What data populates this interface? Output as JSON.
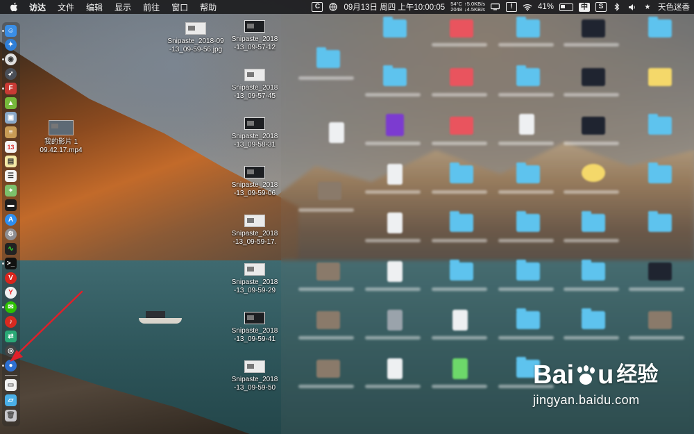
{
  "menubar": {
    "app_name": "访达",
    "menus": [
      "文件",
      "编辑",
      "显示",
      "前往",
      "窗口",
      "帮助"
    ],
    "datetime": "09月13日 周四 上午10:00:05",
    "temperature": "54°C",
    "fan_speed": "2048",
    "net_up": "↑5.0KB/s",
    "net_down": "↓4.5KB/s",
    "battery": "41%",
    "input_method": "中",
    "user_name": "天色迷香"
  },
  "desktop": {
    "movie": {
      "line1": "我的影片 1",
      "line2": "09.42.17.mp4"
    },
    "files": [
      {
        "line1": "Snipaste_2018-09",
        "line2": "-13_09-59-56.jpg"
      },
      {
        "line1": "Snipaste_2018",
        "line2": "-13_09-57-12"
      },
      {
        "line1": "Snipaste_2018",
        "line2": "-13_09-57-45"
      },
      {
        "line1": "Snipaste_2018",
        "line2": "-13_09-58-31"
      },
      {
        "line1": "Snipaste_2018",
        "line2": "-13_09-59-06"
      },
      {
        "line1": "Snipaste_2018",
        "line2": "-13_09-59-17."
      },
      {
        "line1": "Snipaste_2018",
        "line2": "-13_09-59-29"
      },
      {
        "line1": "Snipaste_2018",
        "line2": "-13_09-59-41"
      },
      {
        "line1": "Snipaste_2018",
        "line2": "-13_09-59-50"
      }
    ]
  },
  "dock": {
    "icons": [
      "finder-icon",
      "safari-icon",
      "chrome-icon",
      "launchpad-icon",
      "foxmail-icon",
      "android-icon",
      "preview-icon",
      "notes-icon",
      "calendar-icon",
      "stickies-icon",
      "reminders-icon",
      "maps-icon",
      "terminal-app-icon",
      "app-store-icon",
      "system-preferences-icon",
      "activity-monitor-icon",
      "terminal-icon",
      "vivaldi-icon",
      "yandex-icon",
      "wechat-icon",
      "netease-music-icon",
      "android-file-transfer-icon",
      "camera-icon",
      "qq-browser-icon",
      "document-icon",
      "downloads-folder-icon",
      "trash-icon"
    ]
  },
  "watermark": {
    "brand_left": "Bai",
    "brand_right": "经验",
    "url": "jingyan.baidu.com"
  },
  "colors": {
    "menubar_bg": "#1c1c1e",
    "arrow": "#e0202a",
    "folder": "#5ec3ee"
  }
}
